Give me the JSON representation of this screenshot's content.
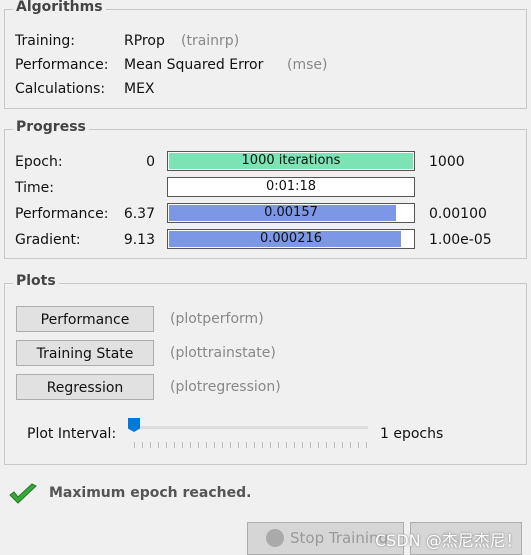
{
  "algorithms": {
    "title": "Algorithms",
    "rows": [
      {
        "label": "Training:",
        "value": "RProp",
        "code": "(trainrp)"
      },
      {
        "label": "Performance:",
        "value": "Mean Squared Error",
        "code": "(mse)"
      },
      {
        "label": "Calculations:",
        "value": "MEX",
        "code": ""
      }
    ]
  },
  "progress": {
    "title": "Progress",
    "rows": [
      {
        "label": "Epoch:",
        "start": "0",
        "bar_text": "1000 iterations",
        "end": "1000",
        "fill": 1.0,
        "color": "#7de3b4"
      },
      {
        "label": "Time:",
        "start": "",
        "bar_text": "0:01:18",
        "end": "",
        "fill": 0,
        "color": "#ffffff"
      },
      {
        "label": "Performance:",
        "start": "6.37",
        "bar_text": "0.00157",
        "end": "0.00100",
        "fill": 0.93,
        "color": "#7b97e6"
      },
      {
        "label": "Gradient:",
        "start": "9.13",
        "bar_text": "0.000216",
        "end": "1.00e-05",
        "fill": 0.95,
        "color": "#7b97e6"
      }
    ]
  },
  "plots": {
    "title": "Plots",
    "buttons": [
      {
        "label": "Performance",
        "code": "(plotperform)"
      },
      {
        "label": "Training State",
        "code": "(plottrainstate)"
      },
      {
        "label": "Regression",
        "code": "(plotregression)"
      }
    ],
    "interval_label": "Plot Interval:",
    "interval_value": "1 epochs",
    "slider_value": 1
  },
  "status": {
    "icon": "checkmark-icon",
    "text": "Maximum epoch reached."
  },
  "footer": {
    "stop_label": "Stop Training",
    "cancel_label": "Cancel",
    "watermark": "CSDN @杰尼杰尼！"
  }
}
